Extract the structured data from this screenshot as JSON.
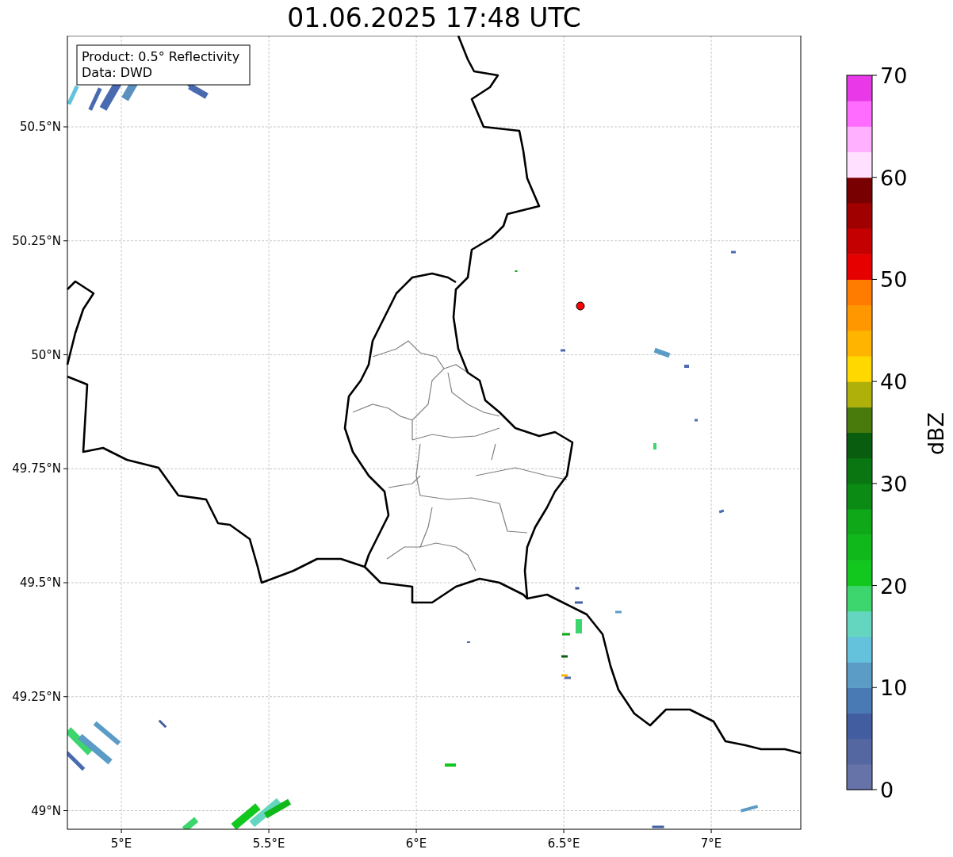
{
  "title": "01.06.2025 17:48 UTC",
  "legend": {
    "lines": [
      "Product: 0.5° Reflectivity",
      "Data: DWD"
    ]
  },
  "map": {
    "x_ticks": [
      "5°E",
      "5.5°E",
      "6°E",
      "6.5°E",
      "7°E"
    ],
    "y_ticks": [
      "50.5°N",
      "50.25°N",
      "50°N",
      "49.75°N",
      "49.5°N",
      "49.25°N",
      "49°N"
    ]
  },
  "colorbar": {
    "label": "dBZ",
    "ticks": [
      "70",
      "60",
      "50",
      "40",
      "30",
      "20",
      "10",
      "0"
    ],
    "bands": [
      {
        "color": "#6673a8"
      },
      {
        "color": "#5467a0"
      },
      {
        "color": "#435ea0"
      },
      {
        "color": "#4a7ab4"
      },
      {
        "color": "#5a9cc6"
      },
      {
        "color": "#64c2dc"
      },
      {
        "color": "#64d6c0"
      },
      {
        "color": "#3dd66e"
      },
      {
        "color": "#12c81e"
      },
      {
        "color": "#10b81c"
      },
      {
        "color": "#0ea818"
      },
      {
        "color": "#0b8a14"
      },
      {
        "color": "#0a7612"
      },
      {
        "color": "#085e0e"
      },
      {
        "color": "#487a0c"
      },
      {
        "color": "#b0b00a"
      },
      {
        "color": "#ffd800"
      },
      {
        "color": "#ffb400"
      },
      {
        "color": "#ff9800"
      },
      {
        "color": "#ff7c00"
      },
      {
        "color": "#e60000"
      },
      {
        "color": "#c40000"
      },
      {
        "color": "#a00000"
      },
      {
        "color": "#780000"
      },
      {
        "color": "#ffe0ff"
      },
      {
        "color": "#ffb0ff"
      },
      {
        "color": "#ff6cff"
      },
      {
        "color": "#e838e8"
      }
    ]
  }
}
